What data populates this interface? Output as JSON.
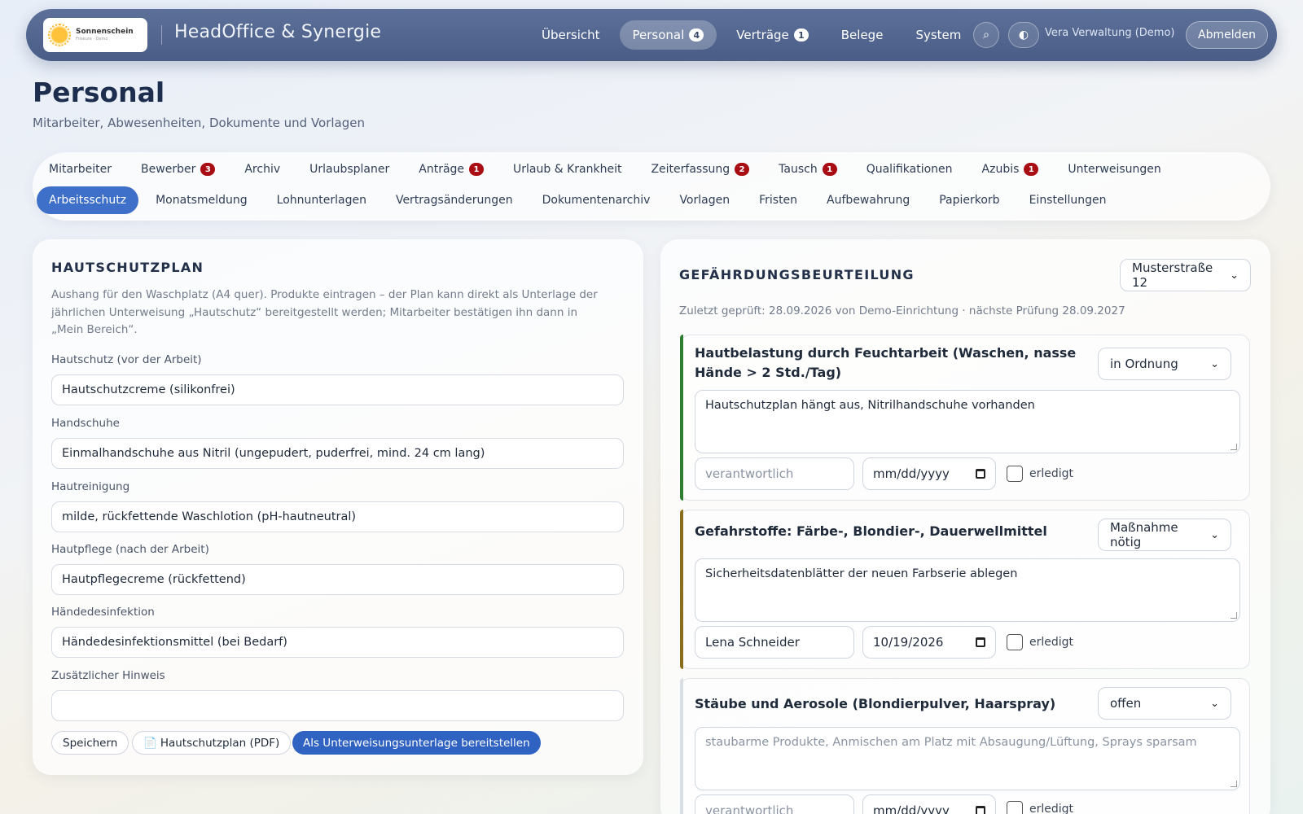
{
  "header": {
    "logo_name": "Sonnenschein",
    "logo_sub": "Friseure · Demo",
    "brand": "HeadOffice & Synergie",
    "nav": [
      {
        "label": "Übersicht",
        "badge": ""
      },
      {
        "label": "Personal",
        "badge": "4"
      },
      {
        "label": "Verträge",
        "badge": "1"
      },
      {
        "label": "Belege",
        "badge": ""
      },
      {
        "label": "System",
        "badge": ""
      }
    ],
    "search_glyph": "⌕",
    "theme_glyph": "◐",
    "user": "Vera Verwaltung (Demo)",
    "logout": "Abmelden"
  },
  "page": {
    "title": "Personal",
    "subtitle": "Mitarbeiter, Abwesenheiten, Dokumente und Vorlagen"
  },
  "tabs": {
    "row1": [
      {
        "label": "Mitarbeiter",
        "badge": ""
      },
      {
        "label": "Bewerber",
        "badge": "3"
      },
      {
        "label": "Archiv",
        "badge": ""
      },
      {
        "label": "Urlaubsplaner",
        "badge": ""
      },
      {
        "label": "Anträge",
        "badge": "1"
      },
      {
        "label": "Urlaub & Krankheit",
        "badge": ""
      },
      {
        "label": "Zeiterfassung",
        "badge": "2"
      },
      {
        "label": "Tausch",
        "badge": "1"
      },
      {
        "label": "Qualifikationen",
        "badge": ""
      },
      {
        "label": "Azubis",
        "badge": "1"
      },
      {
        "label": "Unterweisungen",
        "badge": ""
      }
    ],
    "row2": [
      {
        "label": "Arbeitsschutz"
      },
      {
        "label": "Monatsmeldung"
      },
      {
        "label": "Lohnunterlagen"
      },
      {
        "label": "Vertragsänderungen"
      },
      {
        "label": "Dokumentenarchiv"
      },
      {
        "label": "Vorlagen"
      },
      {
        "label": "Fristen"
      },
      {
        "label": "Aufbewahrung"
      },
      {
        "label": "Papierkorb"
      },
      {
        "label": "Einstellungen"
      }
    ]
  },
  "skin": {
    "title": "HAUTSCHUTZPLAN",
    "description": "Aushang für den Waschplatz (A4 quer). Produkte eintragen – der Plan kann direkt als Unterlage der jährlichen Unterweisung „Hautschutz“ bereitgestellt werden; Mitarbeiter bestätigen ihn dann in „Mein Bereich“.",
    "fields": [
      {
        "label": "Hautschutz (vor der Arbeit)",
        "value": "Hautschutzcreme (silikonfrei)"
      },
      {
        "label": "Handschuhe",
        "value": "Einmalhandschuhe aus Nitril (ungepudert, puderfrei, mind. 24 cm lang)"
      },
      {
        "label": "Hautreinigung",
        "value": "milde, rückfettende Waschlotion (pH-hautneutral)"
      },
      {
        "label": "Hautpflege (nach der Arbeit)",
        "value": "Hautpflegecreme (rückfettend)"
      },
      {
        "label": "Händedesinfektion",
        "value": "Händedesinfektionsmittel (bei Bedarf)"
      },
      {
        "label": "Zusätzlicher Hinweis",
        "value": ""
      }
    ],
    "save": "Speichern",
    "pdf_icon": "📄",
    "pdf": "Hautschutzplan (PDF)",
    "provide": "Als Unterweisungsunterlage bereitstellen"
  },
  "risk": {
    "title": "GEFÄHRDUNGSBEURTEILUNG",
    "location": "Musterstraße 12",
    "meta": "Zuletzt geprüft: 28.09.2026 von Demo-Einrichtung · nächste Prüfung 28.09.2027",
    "responsible_placeholder": "verantwortlich",
    "date_placeholder": "mm/dd/yyyy",
    "done_label": "erledigt",
    "items": [
      {
        "title": "Hautbelastung durch Feuchtarbeit (Waschen, nasse Hände > 2 Std./Tag)",
        "status": "in Ordnung",
        "note": "Hautschutzplan hängt aus, Nitrilhandschuhe vorhanden",
        "responsible": "",
        "date": "",
        "accent": "#2e7d32"
      },
      {
        "title": "Gefahrstoffe: Färbe-, Blondier-, Dauerwellmittel",
        "status": "Maßnahme nötig",
        "note": "Sicherheitsdatenblätter der neuen Farbserie ablegen",
        "responsible": "Lena Schneider",
        "date": "10/19/2026",
        "accent": "#8a6d1a"
      },
      {
        "title": "Stäube und Aerosole (Blondierpulver, Haarspray)",
        "status": "offen",
        "note_placeholder": "staubarme Produkte, Anmischen am Platz mit Absaugung/Lüftung, Sprays sparsam",
        "responsible": "",
        "date": "",
        "accent": "#d9dde4"
      }
    ]
  }
}
